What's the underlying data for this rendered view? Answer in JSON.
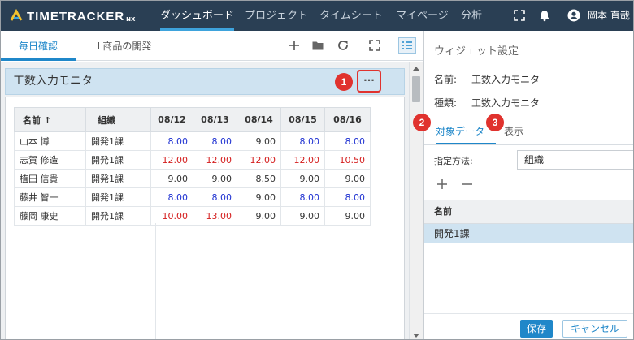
{
  "app": {
    "logo_text": "TIMETRACKER",
    "logo_suffix": "NX"
  },
  "nav": {
    "items": [
      {
        "label": "ダッシュボード",
        "active": true
      },
      {
        "label": "プロジェクト",
        "active": false
      },
      {
        "label": "タイムシート",
        "active": false
      },
      {
        "label": "マイページ",
        "active": false
      },
      {
        "label": "分析",
        "active": false
      }
    ],
    "user_name": "岡本 直哉"
  },
  "tabs": [
    {
      "label": "毎日確認",
      "active": true
    },
    {
      "label": "L商品の開発",
      "active": false
    }
  ],
  "toolbar": {
    "icons": [
      "plus-icon",
      "folder-icon",
      "refresh-icon",
      "fullscreen-icon",
      "list-icon"
    ]
  },
  "widget": {
    "title": "工数入力モニタ",
    "more_label": "···",
    "table": {
      "headers": [
        "名前 ↑",
        "組織",
        "08/12",
        "08/13",
        "08/14",
        "08/15",
        "08/16"
      ],
      "rows": [
        {
          "name": "山本 博",
          "org": "開発1課",
          "values": [
            "8.00",
            "8.00",
            "9.00",
            "8.00",
            "8.00"
          ],
          "colors": [
            "blue",
            "blue",
            "black",
            "blue",
            "blue"
          ]
        },
        {
          "name": "志賀 修造",
          "org": "開発1課",
          "values": [
            "12.00",
            "12.00",
            "12.00",
            "12.00",
            "10.50"
          ],
          "colors": [
            "red",
            "red",
            "red",
            "red",
            "red"
          ]
        },
        {
          "name": "植田 信貴",
          "org": "開発1課",
          "values": [
            "9.00",
            "9.00",
            "8.50",
            "9.00",
            "9.00"
          ],
          "colors": [
            "black",
            "black",
            "black",
            "black",
            "black"
          ]
        },
        {
          "name": "藤井 智一",
          "org": "開発1課",
          "values": [
            "8.00",
            "8.00",
            "9.00",
            "8.00",
            "8.00"
          ],
          "colors": [
            "blue",
            "blue",
            "black",
            "blue",
            "blue"
          ]
        },
        {
          "name": "藤岡 康史",
          "org": "開発1課",
          "values": [
            "10.00",
            "13.00",
            "9.00",
            "9.00",
            "9.00"
          ],
          "colors": [
            "red",
            "red",
            "black",
            "black",
            "black"
          ]
        }
      ]
    }
  },
  "callouts": [
    "1",
    "2",
    "3"
  ],
  "panel": {
    "title": "ウィジェット設定",
    "name_label": "名前:",
    "name_value": "工数入力モニタ",
    "type_label": "種類:",
    "type_value": "工数入力モニタ",
    "tabs": [
      {
        "label": "対象データ",
        "active": true
      },
      {
        "label": "表示",
        "active": false
      }
    ],
    "method_label": "指定方法:",
    "method_value": "組織",
    "list_header": "名前",
    "list_items": [
      "開発1課"
    ],
    "save_label": "保存",
    "cancel_label": "キャンセル"
  },
  "colors": {
    "accent": "#1f87c9",
    "nav_bg": "#2a3f54",
    "highlight": "#e0322e",
    "blue_value": "#1c2fd1",
    "red_value": "#d41c1c"
  }
}
